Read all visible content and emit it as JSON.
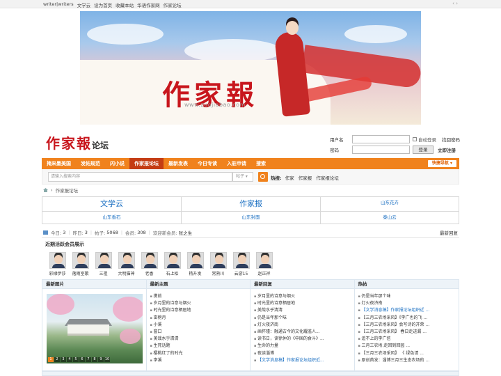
{
  "topbar": {
    "links": [
      "writer|writers",
      "文学云",
      "设为首页",
      "收藏本站",
      "华语作家网",
      "作家论坛"
    ],
    "arrows": "‹ ›"
  },
  "banner": {
    "title": "作家報",
    "url": "www.zuojiabao.com"
  },
  "logo": {
    "main": "作家報",
    "sub": "论坛"
  },
  "login": {
    "username_label": "用户名",
    "password_label": "密码",
    "remember_label": "自动登录",
    "find_password": "找回密码",
    "login_button": "登录",
    "register_link": "立即注册"
  },
  "nav": {
    "items": [
      "掩来墨美国",
      "发帖规范",
      "闪小说",
      "作家报论坛",
      "最新发表",
      "今日专读",
      "入驻申请",
      "搜索"
    ],
    "active_index": 3,
    "quick_nav": "快捷导航 ▾",
    "bar_color": "#f0821d",
    "active_color": "#c43c14"
  },
  "search": {
    "placeholder": "请输入搜索内容",
    "type_select": "帖子 ▾",
    "hot_label": "热搜:",
    "hot_terms": [
      "作家",
      "作家报",
      "作家报论坛"
    ]
  },
  "breadcrumb": {
    "current": "作家报论坛",
    "separator": "›"
  },
  "links_grid": {
    "row1": [
      "文学云",
      "作家报",
      "山东花卉"
    ],
    "row2": [
      "山东香石",
      "山东封面",
      "泰山云"
    ],
    "link_color": "#1a6fc2"
  },
  "stats": {
    "today_label": "今日:",
    "today": "3",
    "yesterday_label": "昨日:",
    "yesterday": "3",
    "posts_label": "帖子:",
    "posts": "5068",
    "members_label": "会员:",
    "members": "308",
    "newest_label": "欢迎新会员:",
    "newest": "张之生",
    "latest_reply": "最新回复"
  },
  "members": {
    "heading": "近期活跃会员展示",
    "names": [
      "彩棣伊莎",
      "落雨室歌",
      "三祖",
      "大明猫神",
      "老香",
      "石上松",
      "杨升发",
      "常熟川",
      "云游15",
      "赵正祥"
    ]
  },
  "panels": {
    "photo_title": "最新图片",
    "photo_pages": [
      "1",
      "2",
      "3",
      "4",
      "5",
      "6",
      "7",
      "8",
      "9",
      "10"
    ],
    "topics_title": "最新主题",
    "topics": [
      "携前",
      "岁月里的诗意与烟火",
      "时光里的诗意栖居地",
      "亩榜月",
      "小溪",
      "窗口",
      "美哉水乎清清",
      "生死话题",
      "樱桃红了的时光",
      "李溪"
    ],
    "replies_title": "最新回复",
    "replies": [
      "岁月里的诗意与烟火",
      "时光里的诗意栖居地",
      "美哉水乎清清",
      "仍是当年那个味",
      "灯火夜济南",
      "画怀瑾：融通古今的文化耀滥人...",
      "读书日，读徐仲的《中国的食斗》...",
      "生命的力量",
      "夜读淄博",
      "【文学消息稿】作家报论坛组织近..."
    ],
    "replies_blue_index": 9,
    "hot_title": "热帖",
    "hot": [
      "仍是当年那个味",
      "灯火夜济南",
      "【文学消息稿】作家报论坛组织近 ...",
      "【三月三农场采风】《李广也的飞 ...",
      "【三月三农场采风】会写诗的开荣 ...",
      "【三月三农场采风】 春日走进漏 ...",
      "追不上的李广信",
      "三月三农场.走回到回园 ...",
      "【三月三农场采风】 《 绿色请 ...",
      "原创首发：淄博三月三生态农场的 ..."
    ],
    "hot_blue_index": 2
  }
}
